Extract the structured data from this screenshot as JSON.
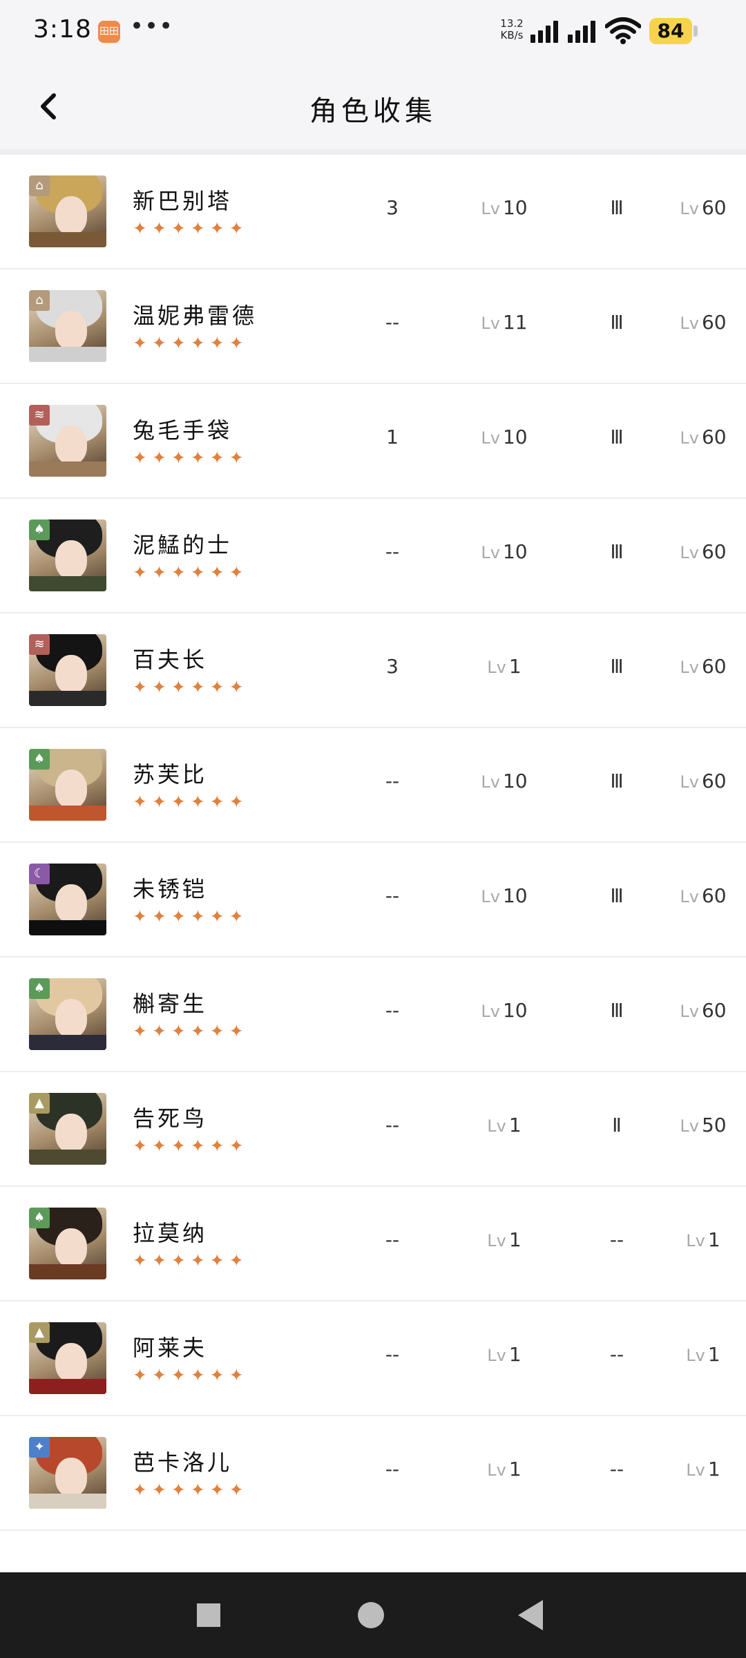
{
  "status": {
    "time": "3:18",
    "app_badge": "田田",
    "more": "•••",
    "net_speed_value": "13.2",
    "net_speed_unit": "KB/s",
    "battery": "84"
  },
  "header": {
    "title": "角色收集",
    "back_icon": "chevron-left-icon"
  },
  "colors": {
    "star": "#e0813e",
    "status_bg": "#f5f5f7",
    "nav_bg": "#1c1c1c",
    "battery": "#f6d34a"
  },
  "level_prefix": "Lv",
  "characters": [
    {
      "name": "新巴别塔",
      "stars": "✦✦✦✦✦✦",
      "c1": "3",
      "c2": "10",
      "c3": "Ⅲ",
      "c4": "60",
      "badge": "tower-icon",
      "badge_color": "#b39a7a",
      "hair": "#c9a65a",
      "cloth": "#7a5a36"
    },
    {
      "name": "温妮弗雷德",
      "stars": "✦✦✦✦✦✦",
      "c1": "--",
      "c2": "11",
      "c3": "Ⅲ",
      "c4": "60",
      "badge": "tower-icon",
      "badge_color": "#b39a7a",
      "hair": "#dcdcdc",
      "cloth": "#cfcfcf"
    },
    {
      "name": "兔毛手袋",
      "stars": "✦✦✦✦✦✦",
      "c1": "1",
      "c2": "10",
      "c3": "Ⅲ",
      "c4": "60",
      "badge": "claw-icon",
      "badge_color": "#b2605a",
      "hair": "#e6e6e6",
      "cloth": "#9b7a5a"
    },
    {
      "name": "泥鯭的士",
      "stars": "✦✦✦✦✦✦",
      "c1": "--",
      "c2": "10",
      "c3": "Ⅲ",
      "c4": "60",
      "badge": "leaf-icon",
      "badge_color": "#5c9a5a",
      "hair": "#1e1e1e",
      "cloth": "#3f4a2e"
    },
    {
      "name": "百夫长",
      "stars": "✦✦✦✦✦✦",
      "c1": "3",
      "c2": "1",
      "c3": "Ⅲ",
      "c4": "60",
      "badge": "claw-icon",
      "badge_color": "#b2605a",
      "hair": "#141414",
      "cloth": "#2a2a2a"
    },
    {
      "name": "苏芙比",
      "stars": "✦✦✦✦✦✦",
      "c1": "--",
      "c2": "10",
      "c3": "Ⅲ",
      "c4": "60",
      "badge": "leaf-icon",
      "badge_color": "#5c9a5a",
      "hair": "#cbb58c",
      "cloth": "#c0562e"
    },
    {
      "name": "未锈铠",
      "stars": "✦✦✦✦✦✦",
      "c1": "--",
      "c2": "10",
      "c3": "Ⅲ",
      "c4": "60",
      "badge": "moon-icon",
      "badge_color": "#8a5aa6",
      "hair": "#1a1a1a",
      "cloth": "#0f0f0f"
    },
    {
      "name": "槲寄生",
      "stars": "✦✦✦✦✦✦",
      "c1": "--",
      "c2": "10",
      "c3": "Ⅲ",
      "c4": "60",
      "badge": "leaf-icon",
      "badge_color": "#5c9a5a",
      "hair": "#e2c8a0",
      "cloth": "#2b2b3a"
    },
    {
      "name": "告死鸟",
      "stars": "✦✦✦✦✦✦",
      "c1": "--",
      "c2": "1",
      "c3": "Ⅱ",
      "c4": "50",
      "badge": "pyramid-icon",
      "badge_color": "#a89a62",
      "hair": "#2c3326",
      "cloth": "#4d4a30"
    },
    {
      "name": "拉莫纳",
      "stars": "✦✦✦✦✦✦",
      "c1": "--",
      "c2": "1",
      "c3": "--",
      "c4": "1",
      "badge": "leaf-icon",
      "badge_color": "#5c9a5a",
      "hair": "#2a211a",
      "cloth": "#6a3a22"
    },
    {
      "name": "阿莱夫",
      "stars": "✦✦✦✦✦✦",
      "c1": "--",
      "c2": "1",
      "c3": "--",
      "c4": "1",
      "badge": "pyramid-icon",
      "badge_color": "#a89a62",
      "hair": "#1b1b1b",
      "cloth": "#8e1f1f"
    },
    {
      "name": "芭卡洛儿",
      "stars": "✦✦✦✦✦✦",
      "c1": "--",
      "c2": "1",
      "c3": "--",
      "c4": "1",
      "badge": "star-icon",
      "badge_color": "#4f7fc9",
      "hair": "#b8482c",
      "cloth": "#d9cfc0"
    }
  ],
  "nav": {
    "recent_icon": "square-icon",
    "home_icon": "circle-icon",
    "back_icon": "triangle-back-icon"
  }
}
